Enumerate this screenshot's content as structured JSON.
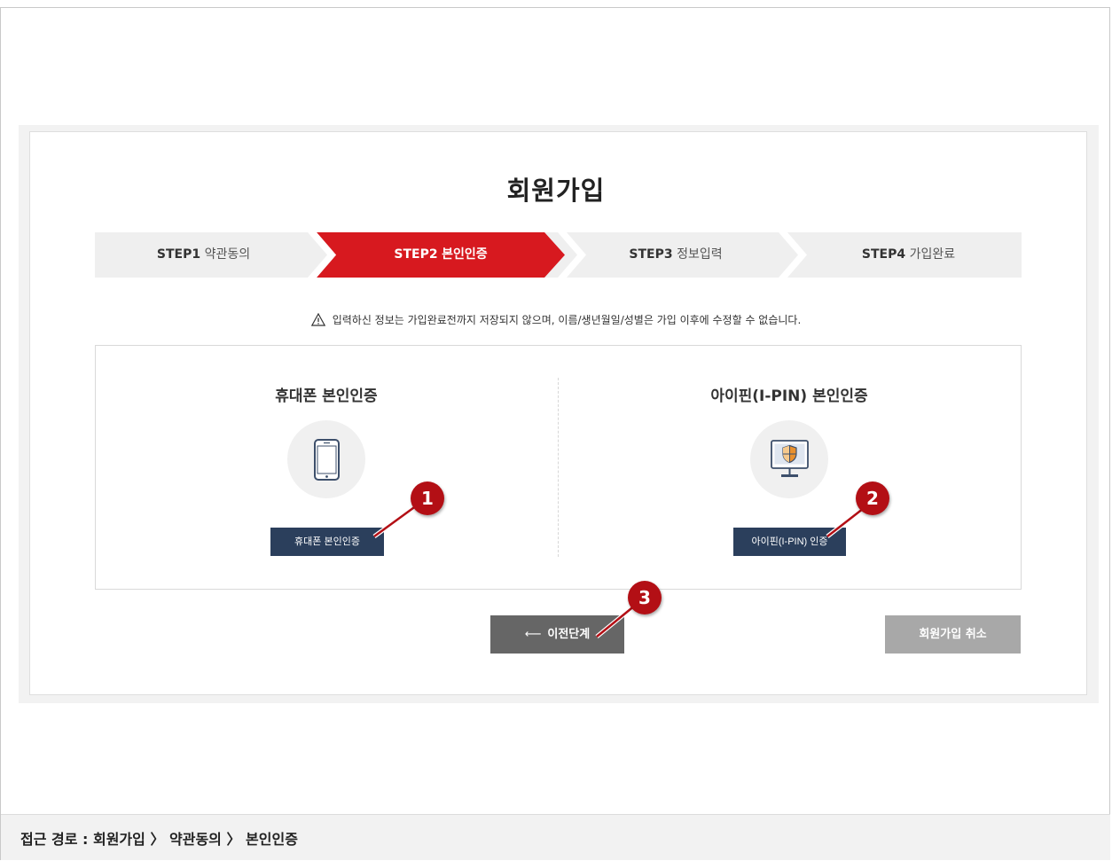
{
  "page": {
    "title": "회원가입"
  },
  "steps": [
    {
      "num": "STEP1",
      "label": "약관동의",
      "active": false
    },
    {
      "num": "STEP2",
      "label": "본인인증",
      "active": true
    },
    {
      "num": "STEP3",
      "label": "정보입력",
      "active": false
    },
    {
      "num": "STEP4",
      "label": "가입완료",
      "active": false
    }
  ],
  "notice": {
    "text": "입력하신 정보는 가입완료전까지 저장되지 않으며, 이름/생년월일/성별은 가입 이후에 수정할 수 없습니다.",
    "icon": "warning-icon"
  },
  "auth": {
    "phone": {
      "title": "휴대폰 본인인증",
      "icon": "mobile-phone-icon",
      "button": "휴대폰 본인인증"
    },
    "ipin": {
      "title": "아이핀(I-PIN) 본인인증",
      "icon": "monitor-shield-icon",
      "button": "아이핀(I-PIN) 인증"
    }
  },
  "buttons": {
    "prev_arrow": "⟵",
    "prev": "이전단계",
    "cancel": "회원가입 취소"
  },
  "markers": [
    "1",
    "2",
    "3"
  ],
  "footer": {
    "path": "접근 경로 : 회원가입 〉 약관동의 〉 본인인증"
  },
  "colors": {
    "active_step": "#d7191f",
    "inactive_step": "#efefef",
    "auth_button": "#2b3f5c",
    "prev_button": "#666666",
    "cancel_button": "#a8a8a8",
    "marker": "#b30f15"
  }
}
